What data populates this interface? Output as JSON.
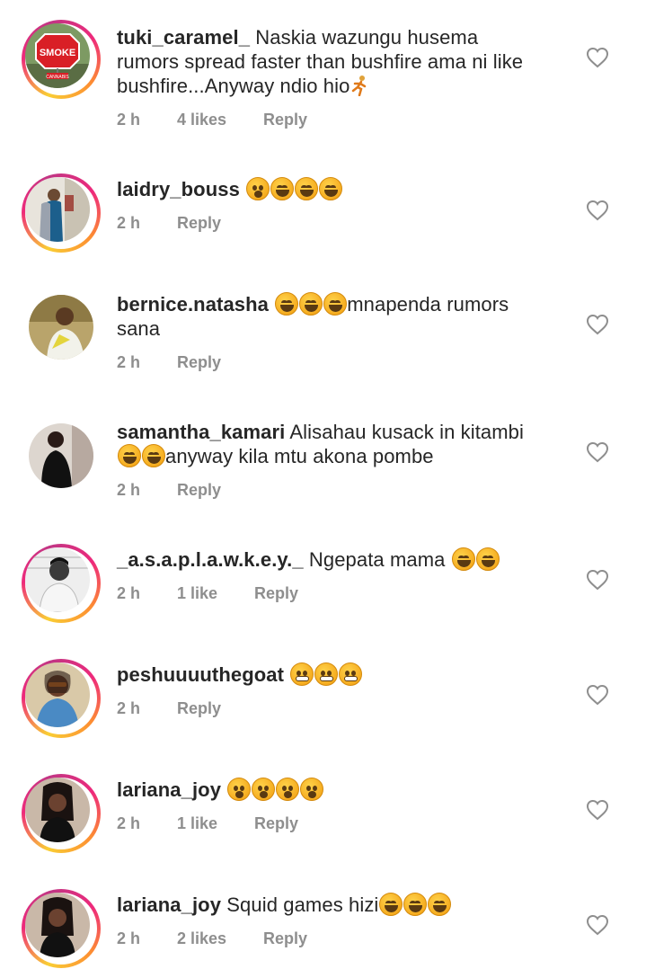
{
  "comments": [
    {
      "username": "tuki_caramel_",
      "line1": "Naskia wazungu husema",
      "line2": "rumors spread faster than bushfire ama ni like",
      "line3": "bushfire...Anyway ndio hio",
      "emoji": "running-person",
      "time": "2 h",
      "likes": "4 likes",
      "reply": "Reply",
      "avatar_sign": "SMOKE",
      "avatar_subsign": "CANNABIS"
    },
    {
      "username": "laidry_bouss",
      "time": "2 h",
      "reply": "Reply"
    },
    {
      "username": "bernice.natasha",
      "text": "mnapenda rumors",
      "line2": "sana",
      "time": "2 h",
      "reply": "Reply"
    },
    {
      "username": "samantha_kamari",
      "text": "Alisahau kusack in kitambi",
      "line2": "anyway kila mtu akona pombe",
      "time": "2 h",
      "reply": "Reply"
    },
    {
      "username": "_a.s.a.p.l.a.w.k.e.y._",
      "text": "Ngepata mama",
      "time": "2 h",
      "likes": "1 like",
      "reply": "Reply"
    },
    {
      "username": "peshuuuuthegoat",
      "time": "2 h",
      "reply": "Reply"
    },
    {
      "username": "lariana_joy",
      "time": "2 h",
      "likes": "1 like",
      "reply": "Reply"
    },
    {
      "username": "lariana_joy",
      "text": "Squid games hizi",
      "time": "2 h",
      "likes": "2 likes",
      "reply": "Reply"
    }
  ],
  "colors": {
    "text": "#262626",
    "meta": "#8e8e8e",
    "story_ring": "#ee2a7b",
    "heart_outline": "#8e8e8e"
  },
  "icons": {
    "heart": "heart-outline-icon",
    "emoji_laugh": "face-with-tears-of-joy",
    "emoji_surprised": "face-with-open-mouth",
    "emoji_grimace": "grimacing-face"
  }
}
